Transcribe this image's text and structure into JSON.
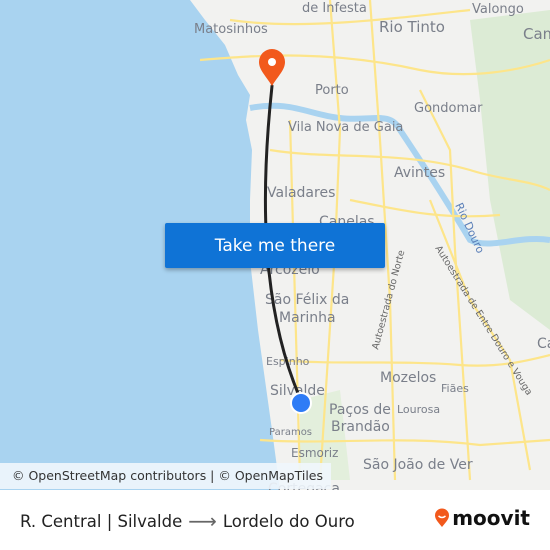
{
  "map": {
    "labels": {
      "de_infesta": "de Infesta",
      "matosinhos": "Matosinhos",
      "rio_tinto": "Rio Tinto",
      "valongo": "Valongo",
      "cam": "Cam",
      "porto": "Porto",
      "gondomar": "Gondomar",
      "vila_nova_de_gaia": "Vila Nova de Gaia",
      "avintes": "Avintes",
      "valadares": "Valadares",
      "canelas": "Canelas",
      "rio_douro": "Rio Douro",
      "arcozelo": "Arcozelo",
      "sao_felix_1": "São Félix da",
      "sao_felix_2": "Marinha",
      "autoestrada_norte": "Autoestrada do Norte",
      "autoestrada_douro": "Autoestrada de Entre Douro e Vouga",
      "espinho": "Espinho",
      "silvalde": "Silvalde",
      "mozelos": "Mozelos",
      "fiaes": "Fiães",
      "pacos_1": "Paços de",
      "pacos_2": "Brandão",
      "lourosa": "Lourosa",
      "paramos": "Paramos",
      "esmoriz": "Esmoriz",
      "sao_joao_de_ver": "São João de Ver",
      "cortegaca": "Cortegaça",
      "ca": "Ca"
    },
    "cta_label": "Take me there",
    "attribution": "© OpenStreetMap contributors | © OpenMapTiles",
    "colors": {
      "sea": "#a9d3f0",
      "land": "#f2f2f0",
      "road": "#fde58a",
      "route": "#222222",
      "destination_pin": "#f2591c",
      "origin_dot": "#2f7cf6",
      "button": "#0f73d6"
    }
  },
  "footer": {
    "origin": "R. Central | Silvalde",
    "arrow_icon": "arrow-right-icon",
    "destination": "Lordelo do Ouro",
    "brand": "moovit"
  }
}
